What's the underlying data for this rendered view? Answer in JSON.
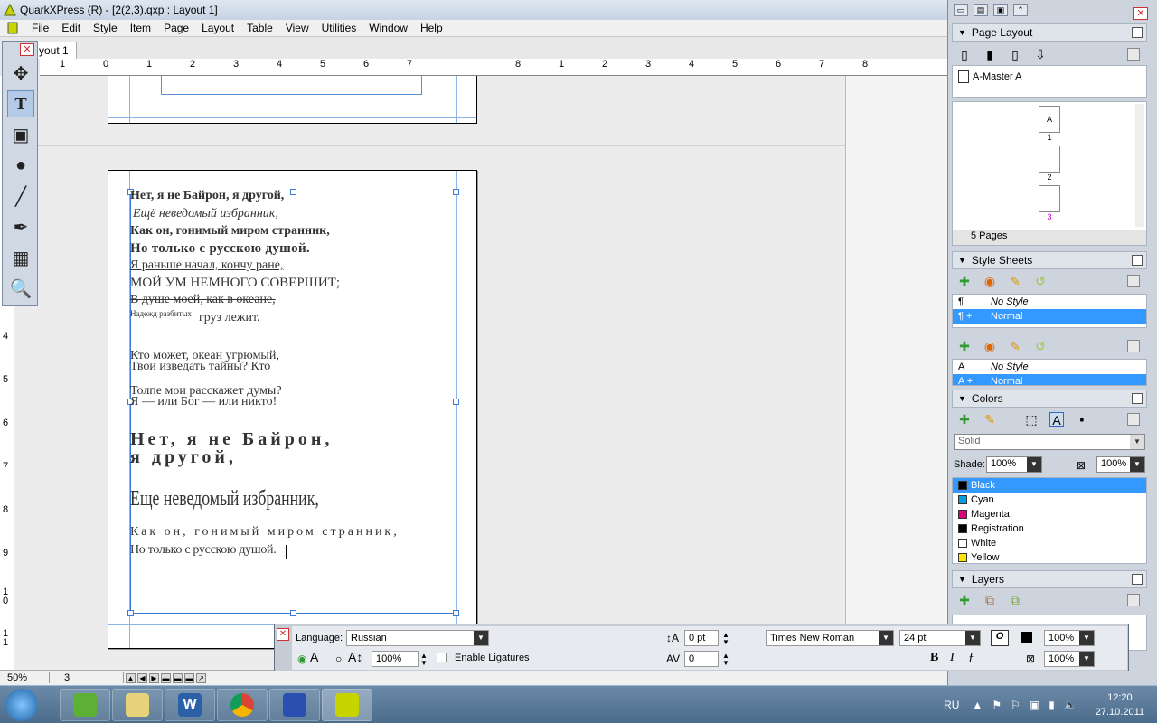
{
  "window": {
    "title": "QuarkXPress (R) - [2(2,3).qxp : Layout 1]"
  },
  "menu": [
    "File",
    "Edit",
    "Style",
    "Item",
    "Page",
    "Layout",
    "Table",
    "View",
    "Utilities",
    "Window",
    "Help"
  ],
  "document": {
    "tab_label": "yout 1",
    "ruler_h": [
      "1",
      "0",
      "1",
      "2",
      "3",
      "4",
      "5",
      "6",
      "7",
      "8",
      "1",
      "2",
      "3",
      "4",
      "5",
      "6",
      "7",
      "8"
    ],
    "ruler_v": [
      "4",
      "5",
      "6",
      "7",
      "8",
      "9",
      "1 0",
      "1 1"
    ],
    "lines": [
      {
        "text": "Нет, я не Байрон, я другой,"
      },
      {
        "text": "Ещё неведомый избранник,"
      },
      {
        "text": "Как он, гонимый миром странник,"
      },
      {
        "text": "Но только с русскою душой."
      },
      {
        "text": "Я раньше начал, кончу ране,"
      },
      {
        "text": "МОЙ УМ НЕМНОГО СОВЕРШИТ;"
      },
      {
        "text": "В душе моей, как в океане,"
      },
      {
        "small": "Надежд разбитых",
        "text": "груз лежит."
      },
      {
        "text": "Кто может, океан угрюмый,"
      },
      {
        "text": "Твои изведать тайны? Кто"
      },
      {
        "text": "Толпе мои расскажет думы?"
      },
      {
        "text": "Я — или Бог — или никто!"
      },
      {
        "text": "Нет, я не Байрон,"
      },
      {
        "text": "я другой,"
      },
      {
        "text": "Еще неведомый избранник,"
      },
      {
        "text": "Как он, гонимый миром странник,"
      },
      {
        "text": "Но только с русскою душой."
      }
    ]
  },
  "status": {
    "zoom": "50%",
    "page": "3"
  },
  "palettes": {
    "page_layout": {
      "title": "Page Layout",
      "master": "A-Master A",
      "pages": [
        {
          "label": "A",
          "num": "1"
        },
        {
          "label": "",
          "num": "2"
        },
        {
          "label": "",
          "num": "3"
        }
      ],
      "count": "5 Pages"
    },
    "style_sheets": {
      "title": "Style Sheets",
      "paragraph": [
        {
          "name": "No Style",
          "mark": "¶"
        },
        {
          "name": "Normal",
          "mark": "¶ +"
        }
      ],
      "character": [
        {
          "name": "No Style",
          "mark": "A"
        },
        {
          "name": "Normal",
          "mark": "A +"
        }
      ]
    },
    "colors": {
      "title": "Colors",
      "fill_mode": "Solid",
      "shade_label": "Shade:",
      "shade": "100%",
      "opacity": "100%",
      "items": [
        {
          "name": "Black",
          "color": "#000000"
        },
        {
          "name": "Cyan",
          "color": "#00a0e0"
        },
        {
          "name": "Magenta",
          "color": "#e0007a"
        },
        {
          "name": "Registration",
          "color": "#000000"
        },
        {
          "name": "White",
          "color": "#ffffff"
        },
        {
          "name": "Yellow",
          "color": "#ffe600"
        }
      ]
    },
    "layers": {
      "title": "Layers"
    }
  },
  "measure": {
    "language_label": "Language:",
    "language": "Russian",
    "scale": "100%",
    "ligatures_label": "Enable Ligatures",
    "leading": "0 pt",
    "tracking": "0",
    "font": "Times New Roman",
    "size": "24 pt",
    "color_shade": "100%",
    "color_opacity": "100%",
    "bold": "B",
    "italic": "I",
    "more": "ƒ"
  },
  "taskbar": {
    "lang": "RU",
    "time": "12:20",
    "date": "27.10.2011"
  }
}
